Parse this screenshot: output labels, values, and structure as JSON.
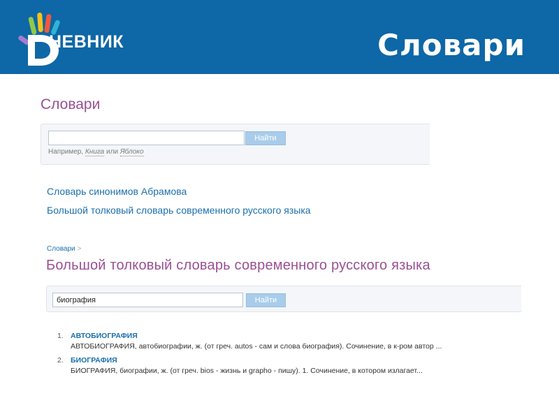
{
  "header": {
    "logo_text": "НЕВНИК",
    "slide_title": "Словари"
  },
  "colors": {
    "topbar": "#0e67a6",
    "section_title": "#9a4f93",
    "link": "#1b6fad",
    "button": "#a9cceb",
    "panel": "#f4f6f9"
  },
  "dictionaries": {
    "title": "Словари",
    "search": {
      "value": "",
      "placeholder": "",
      "button_label": "Найти",
      "example_prefix": "Например,",
      "example_word1": "Книга",
      "example_or": "или",
      "example_word2": "Яблоко"
    },
    "links": [
      "Словарь синонимов Абрамова",
      "Большой толковый словарь современного русского языка"
    ]
  },
  "dictionary_page": {
    "breadcrumb": "Словари",
    "breadcrumb_sep": ">",
    "title": "Большой толковый словарь современного русского языка",
    "search": {
      "value": "биография",
      "button_label": "Найти"
    },
    "results": [
      {
        "number": "1.",
        "term": "АВТОБИОГРАФИЯ",
        "definition": "АВТОБИОГРАФИЯ, автобиографии, ж. (от греч. autos - сам и слова биография). Сочинение, в к-ром автор ..."
      },
      {
        "number": "2.",
        "term": "БИОГРАФИЯ",
        "definition": "БИОГРАФИЯ, биографии, ж. (от греч. bios - жизнь и grapho - пишу). 1. Сочинение, в котором излагает..."
      }
    ]
  }
}
